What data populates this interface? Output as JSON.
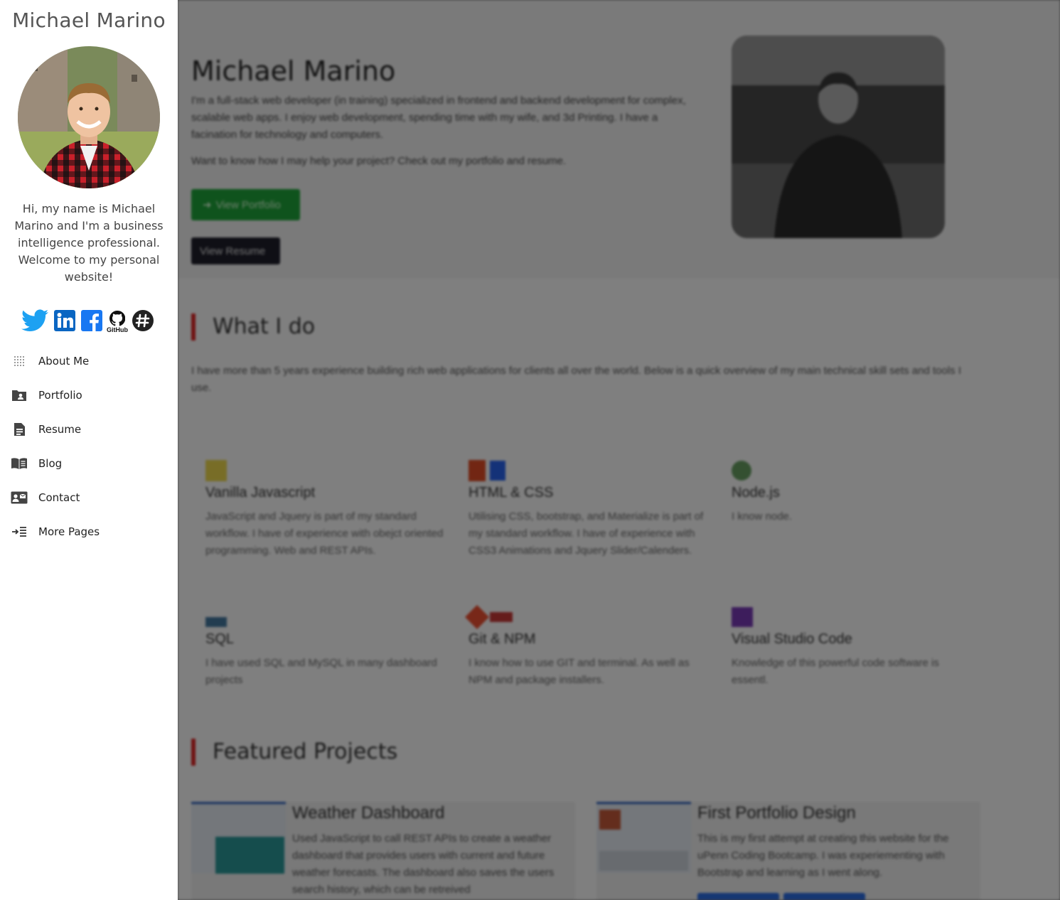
{
  "sidebar": {
    "name": "Michael Marino",
    "bio": "Hi, my name is Michael Marino and I'm a business intelligence professional. Welcome to my personal website!",
    "github_label": "GitHub",
    "nav": [
      {
        "label": "About Me",
        "icon": "grid-dots-icon"
      },
      {
        "label": "Portfolio",
        "icon": "folder-user-icon"
      },
      {
        "label": "Resume",
        "icon": "document-icon"
      },
      {
        "label": "Blog",
        "icon": "open-book-icon"
      },
      {
        "label": "Contact",
        "icon": "contact-card-icon"
      },
      {
        "label": "More Pages",
        "icon": "indent-list-icon"
      }
    ]
  },
  "hero": {
    "title": "Michael Marino",
    "intro": "I'm a full-stack web developer (in training) specialized in frontend and backend development for complex, scalable web apps. I enjoy web development, spending time with my wife, and 3d Printing. I have a facination for technology and computers.",
    "cta": "Want to know how I may help your project? Check out my portfolio and resume.",
    "portfolio_button": "View Portfolio",
    "resume_button": "View Resume"
  },
  "what_i_do": {
    "heading": "What I do",
    "intro": "I have more than 5 years experience building rich web applications for clients all over the world. Below is a quick overview of my main technical skill sets and tools I use.",
    "skills": [
      {
        "title": "Vanilla Javascript",
        "desc": "JavaScript and Jquery is part of my standard workflow. I have of experience with obejct oriented programming. Web and REST APIs."
      },
      {
        "title": "HTML & CSS",
        "desc": "Utilising CSS, bootstrap, and Materialize is part of my standard workflow. I have of experience with CSS3 Animations and Jquery Slider/Calenders."
      },
      {
        "title": "Node.js",
        "desc": "I know node."
      },
      {
        "title": "SQL",
        "desc": "I have used SQL and MySQL in many dashboard projects"
      },
      {
        "title": "Git & NPM",
        "desc": "I know how to use GIT and terminal. As well as NPM and package installers."
      },
      {
        "title": "Visual Studio Code",
        "desc": "Knowledge of this powerful code software is essentl."
      }
    ]
  },
  "featured": {
    "heading": "Featured Projects",
    "projects": [
      {
        "title": "Weather Dashboard",
        "desc": "Used JavaScript to call REST APIs to create a weather dashboard that provides users with current and future weather forecasts. The dashboard also saves the users search history, which can be retreived"
      },
      {
        "title": "First Portfolio Design",
        "desc": "This is my first attempt at creating this website for the uPenn Coding Bootcamp. I was experiementing with Bootstrap and learning as I went along."
      }
    ]
  },
  "colors": {
    "accent_red": "#e02424",
    "portfolio_green": "#1fa73a",
    "resume_dark": "#1e1e2a",
    "twitter_blue": "#1da1f2",
    "linkedin_blue": "#0a66c2",
    "facebook_blue": "#1877f2"
  }
}
